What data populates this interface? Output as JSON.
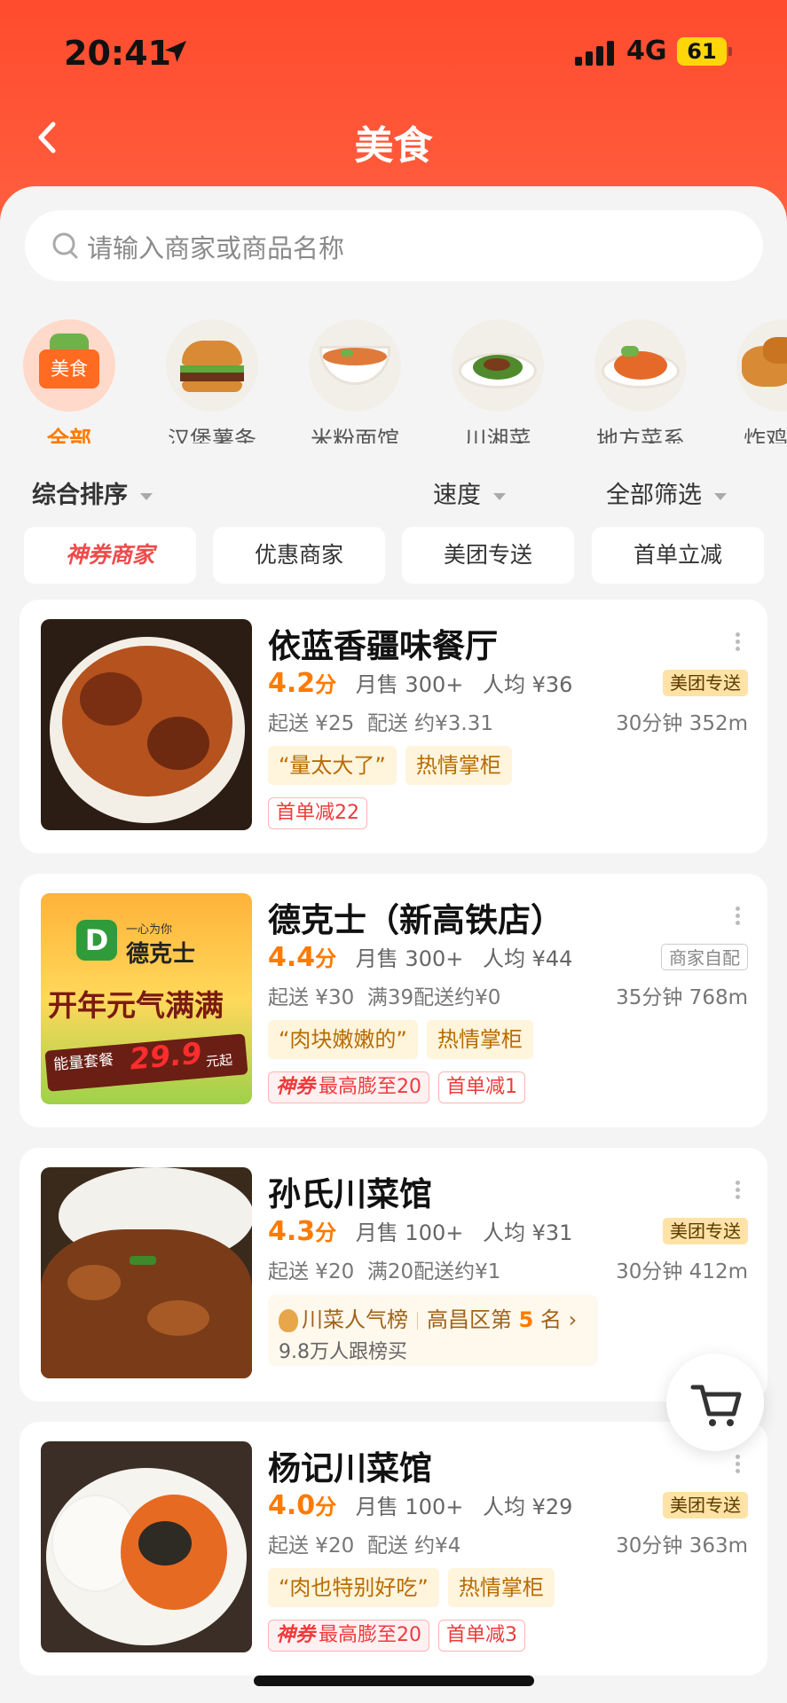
{
  "status": {
    "time": "20:41",
    "network": "4G",
    "battery": "61"
  },
  "header": {
    "title": "美食"
  },
  "search": {
    "placeholder": "请输入商家或商品名称"
  },
  "categories": [
    {
      "label": "全部",
      "badge": "美食",
      "active": true
    },
    {
      "label": "汉堡薯条"
    },
    {
      "label": "米粉面馆"
    },
    {
      "label": "川湘菜"
    },
    {
      "label": "地方菜系"
    },
    {
      "label": "炸鸡"
    }
  ],
  "sort": {
    "overall": "综合排序",
    "speed": "速度",
    "filter": "全部筛选"
  },
  "chips": [
    "神券商家",
    "优惠商家",
    "美团专送",
    "首单立减"
  ],
  "shops": [
    {
      "name": "依蓝香疆味餐厅",
      "score": "4.2",
      "score_unit": "分",
      "monthly": "月售 300+",
      "avg": "人均 ¥36",
      "delivery_tag": "美团专送",
      "min_order": "起送 ¥25",
      "fee": "配送 约¥3.31",
      "time_dist": "30分钟 352m",
      "quotes": [
        "“量太大了”",
        "热情掌柜"
      ],
      "promos": [
        "首单减22"
      ]
    },
    {
      "name": "德克士（新高铁店）",
      "score": "4.4",
      "score_unit": "分",
      "monthly": "月售 300+",
      "avg": "人均 ¥44",
      "delivery_tag": "商家自配",
      "min_order": "起送 ¥30",
      "fee": "满39配送约¥0",
      "time_dist": "35分钟 768m",
      "quotes": [
        "“肉块嫩嫩的”",
        "热情掌柜"
      ],
      "promo_god": {
        "brand": "神券",
        "text": "最高膨至20"
      },
      "promos": [
        "首单减1"
      ],
      "poster": {
        "brand": "德克士",
        "slogan_small": "一心为你",
        "headline": "开年元气满满",
        "sub": "能量套餐",
        "price": "29.9",
        "price_unit": "元起"
      }
    },
    {
      "name": "孙氏川菜馆",
      "score": "4.3",
      "score_unit": "分",
      "monthly": "月售 100+",
      "avg": "人均 ¥31",
      "delivery_tag": "美团专送",
      "min_order": "起送 ¥20",
      "fee": "满20配送约¥1",
      "time_dist": "30分钟 412m",
      "rank": {
        "list": "川菜人气榜",
        "area": "高昌区第",
        "num": "5",
        "unit": "名",
        "followers": "9.8万人跟榜买"
      }
    },
    {
      "name": "杨记川菜馆",
      "score": "4.0",
      "score_unit": "分",
      "monthly": "月售 100+",
      "avg": "人均 ¥29",
      "delivery_tag": "美团专送",
      "min_order": "起送 ¥20",
      "fee": "配送 约¥4",
      "time_dist": "30分钟 363m",
      "quotes": [
        "“肉也特别好吃”",
        "热情掌柜"
      ],
      "promo_god": {
        "brand": "神券",
        "text": "最高膨至20"
      },
      "promos": [
        "首单减3"
      ]
    }
  ],
  "colors": {
    "header": "#ff4b2e",
    "accent": "#ff7a00",
    "promo_red": "#ee3b3b"
  }
}
